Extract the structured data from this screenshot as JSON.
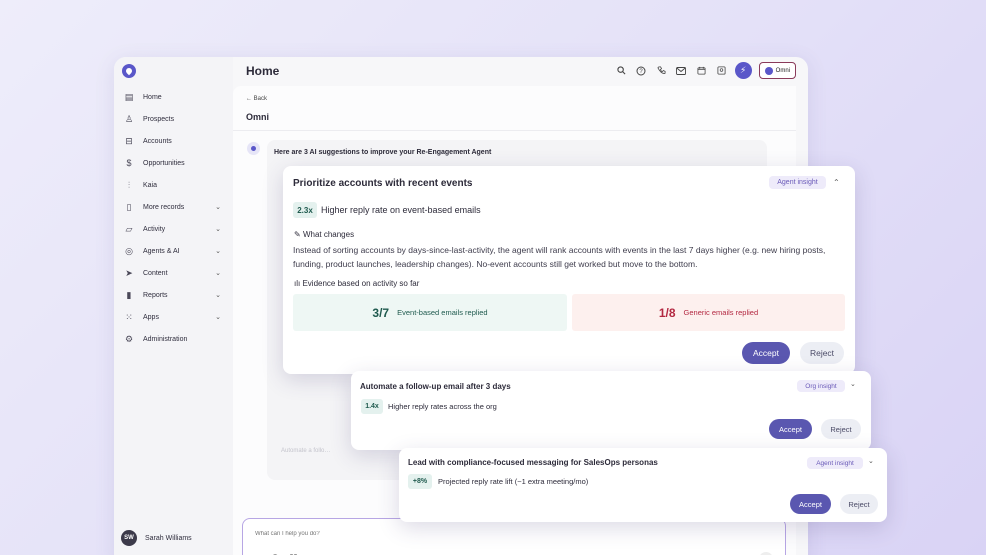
{
  "header": {
    "title": "Home",
    "omni_label": "Omni"
  },
  "sidebar": {
    "items": [
      {
        "label": "Home",
        "icon": "layout-icon",
        "glyph": "▤",
        "chev": ""
      },
      {
        "label": "Prospects",
        "icon": "user-icon",
        "glyph": "♙",
        "chev": ""
      },
      {
        "label": "Accounts",
        "icon": "briefcase-icon",
        "glyph": "⊟",
        "chev": ""
      },
      {
        "label": "Opportunities",
        "icon": "dollar-icon",
        "glyph": "$",
        "chev": ""
      },
      {
        "label": "Kaia",
        "icon": "waveform-icon",
        "glyph": "⫶",
        "chev": ""
      },
      {
        "label": "More records",
        "icon": "file-icon",
        "glyph": "▯",
        "chev": "⌄"
      },
      {
        "label": "Activity",
        "icon": "activity-icon",
        "glyph": "▱",
        "chev": "⌄"
      },
      {
        "label": "Agents & AI",
        "icon": "agent-icon",
        "glyph": "◎",
        "chev": "⌄"
      },
      {
        "label": "Content",
        "icon": "send-icon",
        "glyph": "➤",
        "chev": "⌄"
      },
      {
        "label": "Reports",
        "icon": "bar-chart-icon",
        "glyph": "▮",
        "chev": "⌄"
      },
      {
        "label": "Apps",
        "icon": "grid-icon",
        "glyph": "⁙",
        "chev": "⌄"
      },
      {
        "label": "Administration",
        "icon": "gear-icon",
        "glyph": "⚙",
        "chev": ""
      }
    ],
    "user": {
      "initials": "SW",
      "name": "Sarah Williams"
    }
  },
  "main": {
    "back_label": "← Back",
    "title": "Omni",
    "intro": "Here are 3 AI suggestions to improve your Re-Engagement Agent",
    "ghost_text": "Automate a follo…",
    "composer_placeholder": "What can I help you do?"
  },
  "suggestions": [
    {
      "title": "Prioritize accounts with recent events",
      "tag": "Agent insight",
      "metric": "2.3x",
      "metric_text": "Higher reply rate on event-based emails",
      "what_changes_label": "What changes",
      "description": "Instead of sorting accounts by days-since-last-activity, the agent will rank accounts with events in the last 7 days higher (e.g. new hiring posts, funding, product launches, leadership changes). No-event accounts still get worked but move to the bottom.",
      "evidence_label": "Evidence based on activity so far",
      "evidence": [
        {
          "value": "3/7",
          "label": "Event-based emails replied",
          "color": "#1f5a4e"
        },
        {
          "value": "1/8",
          "label": "Generic emails replied",
          "color": "#b32841"
        }
      ],
      "accept": "Accept",
      "reject": "Reject"
    },
    {
      "title": "Automate a follow-up email after 3 days",
      "tag": "Org insight",
      "metric": "1.4x",
      "metric_text": "Higher reply rates across the org",
      "accept": "Accept",
      "reject": "Reject"
    },
    {
      "title": "Lead with compliance-focused messaging for SalesOps personas",
      "tag": "Agent insight",
      "metric": "+8%",
      "metric_text": "Projected reply rate lift (~1 extra meeting/mo)",
      "accept": "Accept",
      "reject": "Reject"
    }
  ],
  "colors": {
    "accent": "#5a57c9",
    "accept": "#5a57b0",
    "tag_bg": "#eeebfa"
  }
}
